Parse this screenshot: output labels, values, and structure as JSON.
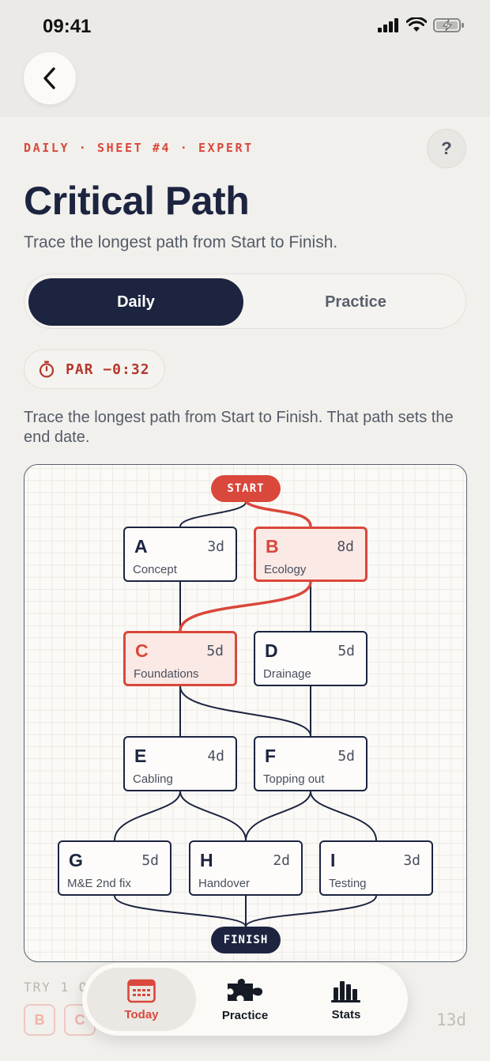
{
  "status": {
    "time": "09:41"
  },
  "header": {
    "eyebrow": "DAILY · SHEET #4 · EXPERT",
    "title": "Critical Path",
    "subtitle": "Trace the longest path from Start to Finish.",
    "help_label": "?"
  },
  "mode_toggle": {
    "daily": "Daily",
    "practice": "Practice",
    "selected": "Daily"
  },
  "par": {
    "label": "PAR −0:32",
    "icon": "stopwatch-icon"
  },
  "instructions": "Trace the longest path from Start to Finish. That path sets the end date.",
  "board": {
    "start_label": "START",
    "finish_label": "FINISH",
    "nodes": [
      {
        "id": "A",
        "duration": "3d",
        "name": "Concept",
        "critical": false
      },
      {
        "id": "B",
        "duration": "8d",
        "name": "Ecology",
        "critical": true
      },
      {
        "id": "C",
        "duration": "5d",
        "name": "Foundations",
        "critical": true
      },
      {
        "id": "D",
        "duration": "5d",
        "name": "Drainage",
        "critical": false
      },
      {
        "id": "E",
        "duration": "4d",
        "name": "Cabling",
        "critical": false
      },
      {
        "id": "F",
        "duration": "5d",
        "name": "Topping out",
        "critical": false
      },
      {
        "id": "G",
        "duration": "5d",
        "name": "M&E 2nd fix",
        "critical": false
      },
      {
        "id": "H",
        "duration": "2d",
        "name": "Handover",
        "critical": false
      },
      {
        "id": "I",
        "duration": "3d",
        "name": "Testing",
        "critical": false
      }
    ]
  },
  "footer": {
    "try_label": "TRY 1 O",
    "selected_chips": [
      "B",
      "C"
    ],
    "total": "13d"
  },
  "tabbar": {
    "today": "Today",
    "practice": "Practice",
    "stats": "Stats"
  },
  "colors": {
    "accent": "#d9483b",
    "navy": "#1c2440",
    "background": "#f1f0ec"
  }
}
